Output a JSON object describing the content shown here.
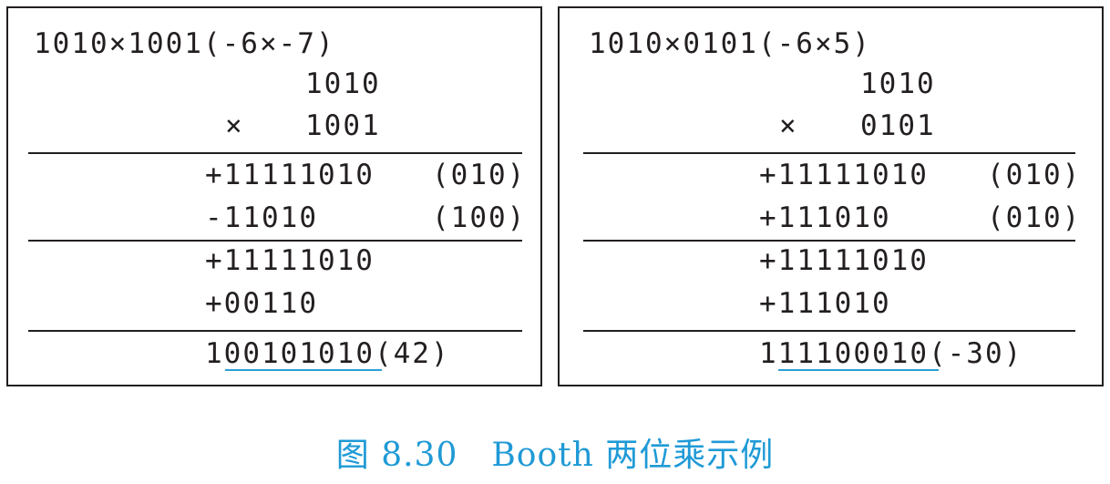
{
  "caption": "图 8.30　Booth 两位乘示例",
  "colors": {
    "text": "#231f20",
    "caption": "#1f9ad6",
    "underline": "#2a9fd6"
  },
  "left": {
    "header": "1010×1001(-6×-7)",
    "multiplicand": "1010",
    "times_sign": "×",
    "multiplier": "1001",
    "step1": {
      "op": "+11111010",
      "bits": "(010)"
    },
    "step2": {
      "op": "-11010",
      "bits": "(100)"
    },
    "sum1": "+11111010",
    "sum2": "+00110",
    "result_prefix": "1",
    "result_underlined": "00101010",
    "result_value": "(42)"
  },
  "right": {
    "header": "1010×0101(-6×5)",
    "multiplicand": "1010",
    "times_sign": "×",
    "multiplier": "0101",
    "step1": {
      "op": "+11111010",
      "bits": "(010)"
    },
    "step2": {
      "op": "+111010",
      "bits": "(010)"
    },
    "sum1": "+11111010",
    "sum2": "+111010",
    "result_prefix": "1",
    "result_underlined": "11100010",
    "result_value": "(-30)"
  }
}
